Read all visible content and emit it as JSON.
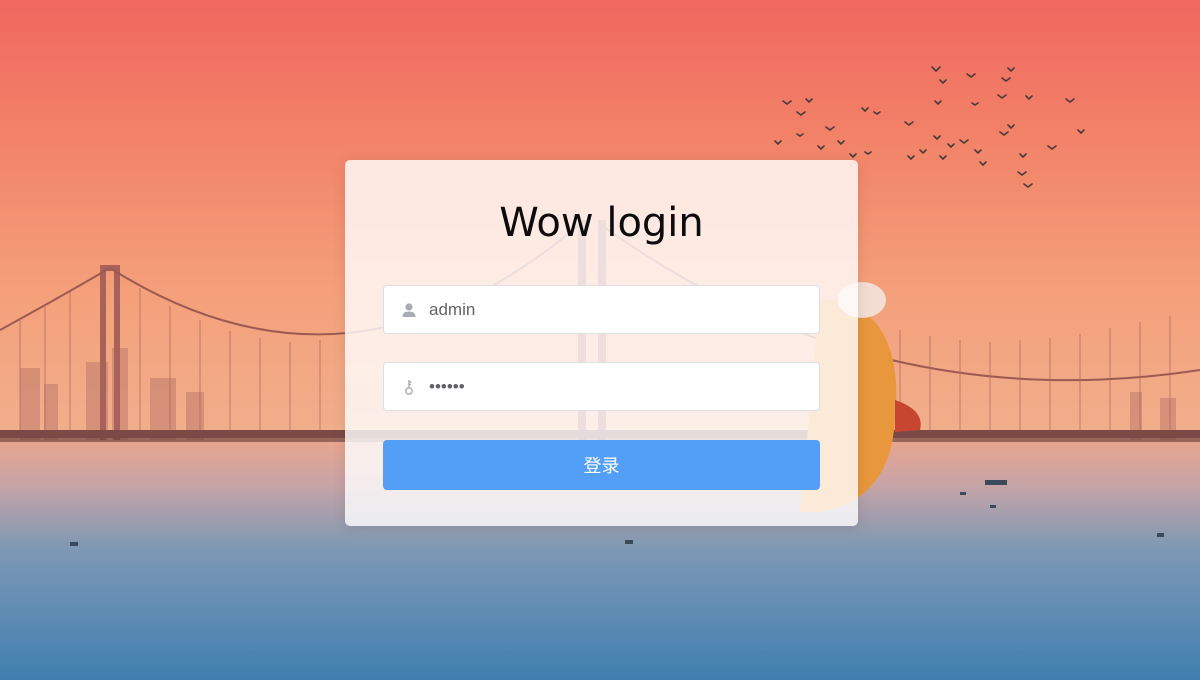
{
  "login": {
    "title": "Wow login",
    "username_value": "admin",
    "password_value": "admin1",
    "submit_label": "登录"
  },
  "icons": {
    "username": "user-icon",
    "password": "key-icon"
  },
  "colors": {
    "primary_button": "#539ff8",
    "sky_top": "#f0675f",
    "sky_bottom": "#f4a07a",
    "water": "#3f7fb0"
  }
}
